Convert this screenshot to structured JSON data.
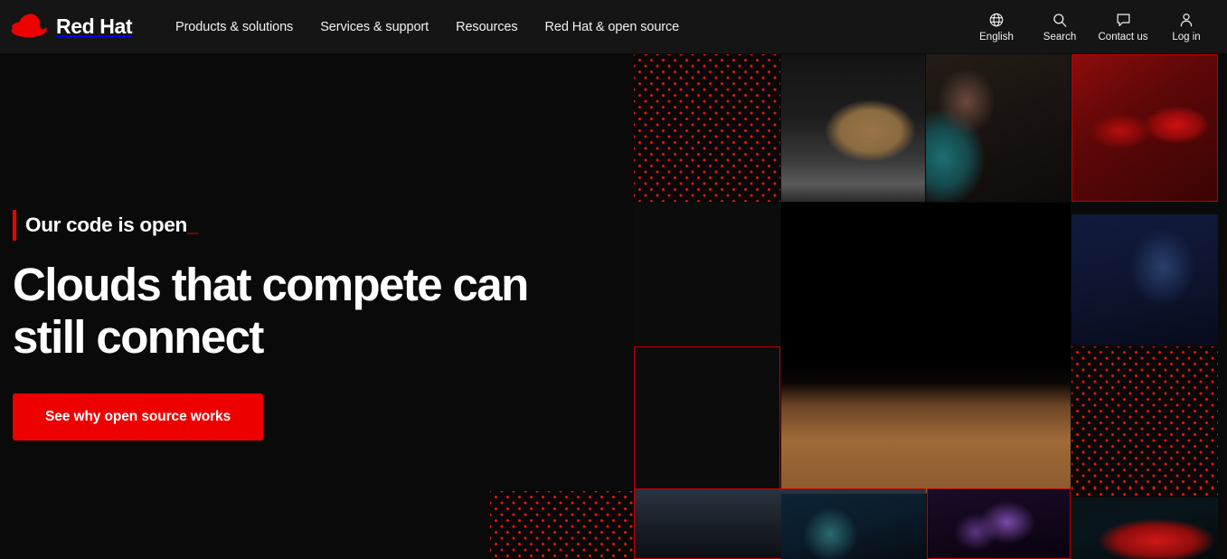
{
  "brand": {
    "name": "Red Hat",
    "logo_icon": "red-hat-fedora-logo",
    "accent_color": "#ee0000"
  },
  "nav": {
    "items": [
      {
        "label": "Products & solutions"
      },
      {
        "label": "Services & support"
      },
      {
        "label": "Resources"
      },
      {
        "label": "Red Hat & open source"
      }
    ],
    "utility": [
      {
        "label": "English",
        "icon": "globe-icon"
      },
      {
        "label": "Search",
        "icon": "search-icon"
      },
      {
        "label": "Contact us",
        "icon": "chat-bubble-icon"
      },
      {
        "label": "Log in",
        "icon": "user-icon"
      }
    ]
  },
  "hero": {
    "eyebrow": "Our code is open",
    "eyebrow_caret": "_",
    "headline": "Clouds that compete can still connect",
    "cta_label": "See why open source works",
    "cta_color": "#ee0000"
  },
  "mosaic": {
    "tiles": [
      {
        "name": "dot-pattern-tile-top-left",
        "kind": "dots",
        "outline": false
      },
      {
        "name": "package-conveyor-photo",
        "kind": "ph-box",
        "outline": false
      },
      {
        "name": "soldering-technician-photo",
        "kind": "ph-solder",
        "outline": false
      },
      {
        "name": "red-hats-photo",
        "kind": "ph-hats",
        "outline": true
      },
      {
        "name": "empty-outline-tile",
        "kind": "ph-dark",
        "outline": true
      },
      {
        "name": "mars-rover-photo",
        "kind": "ph-rover",
        "outline": false
      },
      {
        "name": "conference-stage-photo",
        "kind": "ph-stage",
        "outline": false
      },
      {
        "name": "dot-pattern-tile-right",
        "kind": "dots",
        "outline": false
      },
      {
        "name": "dot-pattern-tile-bottom",
        "kind": "dots",
        "outline": false
      },
      {
        "name": "night-portrait-photo",
        "kind": "ph-night",
        "outline": true
      },
      {
        "name": "developer-laptop-photo",
        "kind": "ph-laptop",
        "outline": false
      },
      {
        "name": "audience-crowd-photo",
        "kind": "ph-crowd",
        "outline": true
      },
      {
        "name": "red-car-photo",
        "kind": "ph-car",
        "outline": false
      }
    ]
  }
}
